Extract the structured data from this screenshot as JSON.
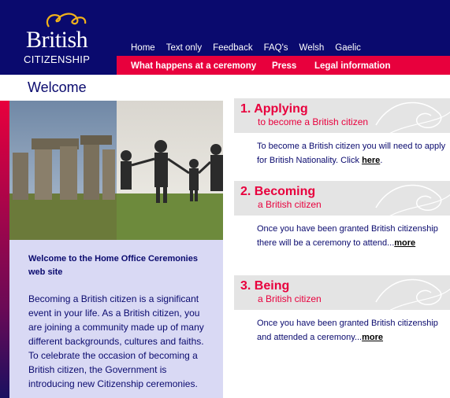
{
  "logo": {
    "line1": "British",
    "line2": "CITIZENSHIP"
  },
  "topnav": [
    "Home",
    "Text only",
    "Feedback",
    "FAQ's",
    "Welsh",
    "Gaelic"
  ],
  "subnav": [
    "What happens at a ceremony",
    "Press",
    "Legal information"
  ],
  "page_title": "Welcome",
  "intro": {
    "title": "Welcome to the Home Office Ceremonies web site",
    "body": "Becoming a British citizen is a significant event in your life. As a British citizen, you are joining a community made up of many different backgrounds, cultures and faiths. To celebrate the occasion of becoming a British citizen, the Government is introducing new Citizenship ceremonies."
  },
  "sections": [
    {
      "num": "1.",
      "heading": "Applying",
      "sub": "to become a British citizen",
      "body": "To become a British citizen you will need to apply for British Nationality. Click ",
      "link": "here",
      "tail": "."
    },
    {
      "num": "2.",
      "heading": "Becoming",
      "sub": "a British citizen",
      "body": "Once you have been granted British citizenship there will be a ceremony to attend...",
      "link": "more",
      "tail": ""
    },
    {
      "num": "3.",
      "heading": "Being",
      "sub": "a British citizen",
      "body": "Once you have been granted British citizenship and attended a ceremony...",
      "link": "more",
      "tail": ""
    }
  ],
  "colors": {
    "navy": "#0a0a6e",
    "accent": "#e8003d",
    "intro_bg": "#d9d9f4",
    "section_bg": "#e4e4e4"
  }
}
